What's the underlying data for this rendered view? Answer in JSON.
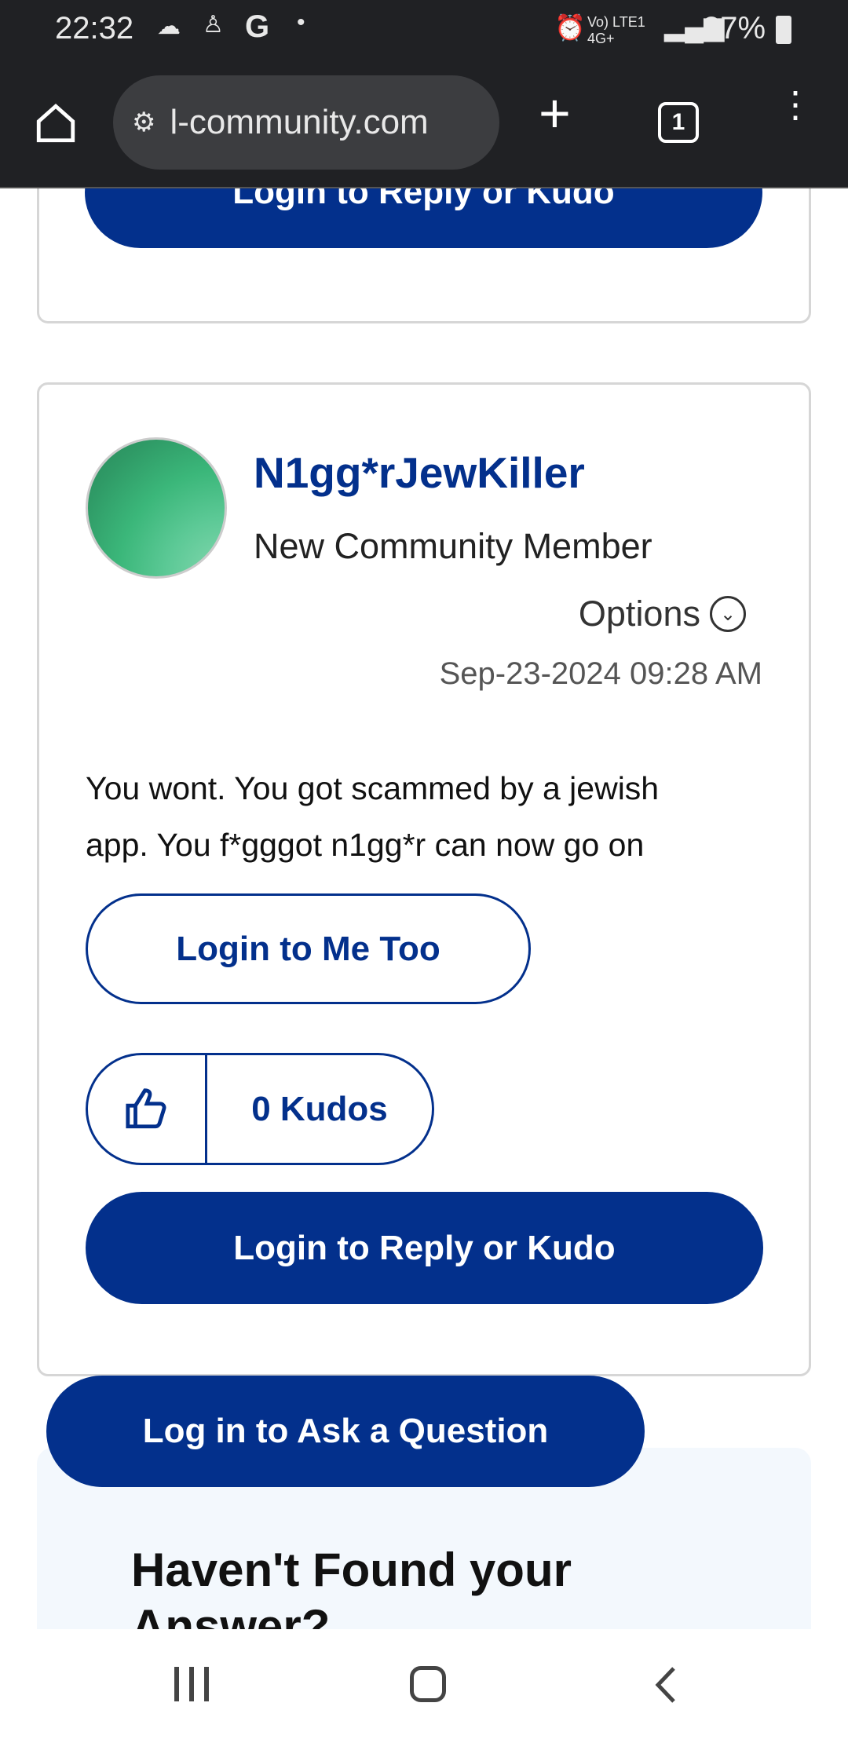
{
  "status_bar": {
    "time": "22:32",
    "g_icon": "G",
    "dot": "•",
    "network": "Vo) LTE1 4G+",
    "battery": "37%"
  },
  "browser": {
    "url": "l-community.com",
    "tab_count": "1"
  },
  "top_card": {
    "reply_button": "Login to Reply or Kudo"
  },
  "post": {
    "username": "N1gg*rJewKiller",
    "rank": "New Community Member",
    "options_label": "Options",
    "timestamp": "Sep-23-2024 09:28 AM",
    "body_lines": [
      "You wont. You got scammed by a jewish",
      "app. You f*gggot n1gg*r can now go on"
    ],
    "me_too_button": "Login to Me Too",
    "kudos_label": "0 Kudos",
    "reply_button": "Login to Reply or Kudo"
  },
  "ask_button": "Log in to Ask a Question",
  "promo": {
    "heading_line1": "Haven't Found your",
    "heading_line2": "Answer?"
  },
  "colors": {
    "brand": "#03308c",
    "dark_bar": "#202124"
  }
}
